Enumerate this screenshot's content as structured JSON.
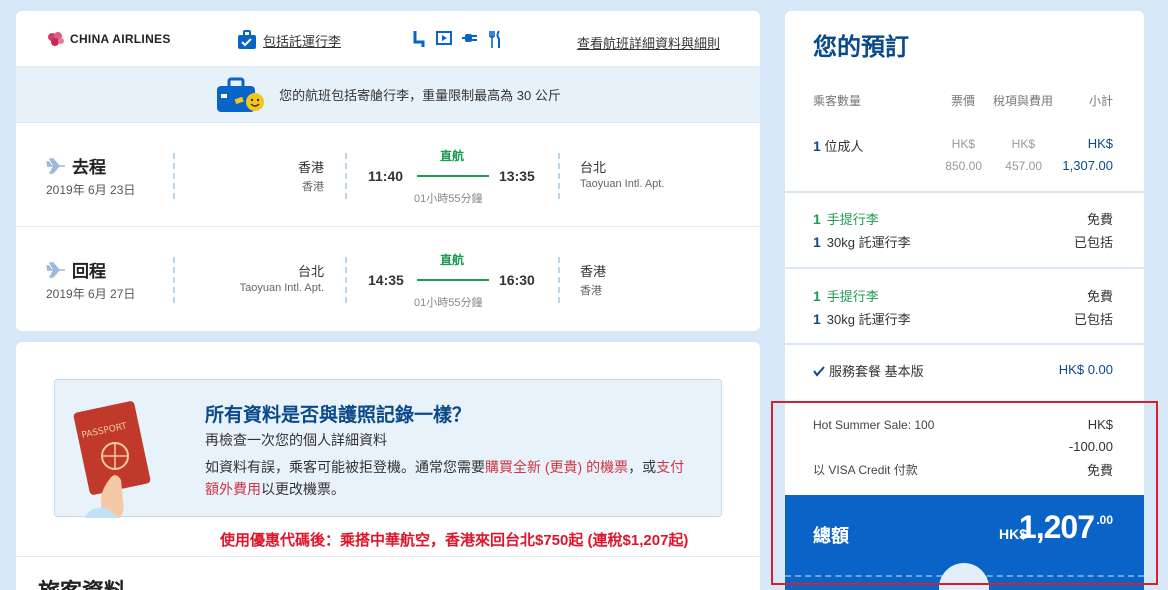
{
  "flight_card": {
    "airline": "CHINA AIRLINES",
    "baggage_included_link": "包括託運行李",
    "details_link": "查看航班詳細資料與細則",
    "baggage_notice": "您的航班包括寄艙行李，重量限制最高為 30 公斤",
    "outbound": {
      "label": "去程",
      "date": "2019年 6月 23日",
      "from_city": "香港",
      "from_airport": "香港",
      "depart_time": "11:40",
      "stop_type": "直航",
      "arrive_time": "13:35",
      "duration": "01小時55分鐘",
      "to_city": "台北",
      "to_airport": "Taoyuan Intl. Apt."
    },
    "inbound": {
      "label": "回程",
      "date": "2019年 6月 27日",
      "from_city": "台北",
      "from_airport": "Taoyuan Intl. Apt.",
      "depart_time": "14:35",
      "stop_type": "直航",
      "arrive_time": "16:30",
      "duration": "01小時55分鐘",
      "to_city": "香港",
      "to_airport": "香港"
    }
  },
  "passport_card": {
    "title": "所有資料是否與護照記錄一樣？",
    "subtitle": "再檢查一次您的個人詳細資料",
    "body_part1": "如資料有誤，乘客可能被拒登機。通常您需要",
    "body_red1": "購買全新 (更貴) 的機票",
    "body_part2": "，或",
    "body_red2": "支付額外費用",
    "body_part3": "以更改機票。",
    "passport_word": "PASSPORT",
    "bottom_heading": "旅客資料"
  },
  "promo_banner": "使用優惠代碼後：乘搭中華航空，香港來回台北$750起 (連稅$1,207起)",
  "booking": {
    "title": "您的預訂",
    "columns": {
      "passengers": "乘客數量",
      "fare": "票價",
      "taxes": "稅項與費用",
      "subtotal": "小計"
    },
    "adult": {
      "count": "1",
      "label": "位成人",
      "fare_cur": "HK$",
      "fare": "850.00",
      "tax_cur": "HK$",
      "tax": "457.00",
      "sub_cur": "HK$",
      "sub": "1,307.00"
    },
    "bags_outbound": {
      "hand_count": "1",
      "hand_label": "手提行李",
      "hand_value": "免費",
      "checked_count": "1",
      "checked_label": "30kg 託運行李",
      "checked_value": "已包括"
    },
    "bags_inbound": {
      "hand_count": "1",
      "hand_label": "手提行李",
      "hand_value": "免費",
      "checked_count": "1",
      "checked_label": "30kg 託運行李",
      "checked_value": "已包括"
    },
    "service": {
      "label": "服務套餐 基本版",
      "value": "HK$ 0.00"
    },
    "promo": {
      "label": "Hot Summer Sale: 100",
      "cur": "HK$",
      "value": "-100.00"
    },
    "payment": {
      "label": "以 VISA Credit 付款",
      "value": "免費"
    },
    "total": {
      "label": "總額",
      "cur": "HK$",
      "amount": "1,207",
      "decimals": ".00"
    }
  },
  "colors": {
    "navy": "#0a4a8a",
    "green": "#1f9a52",
    "total_blue": "#0a63c7",
    "highlight_red": "#d81f2d",
    "promo_red": "#e0142a"
  }
}
